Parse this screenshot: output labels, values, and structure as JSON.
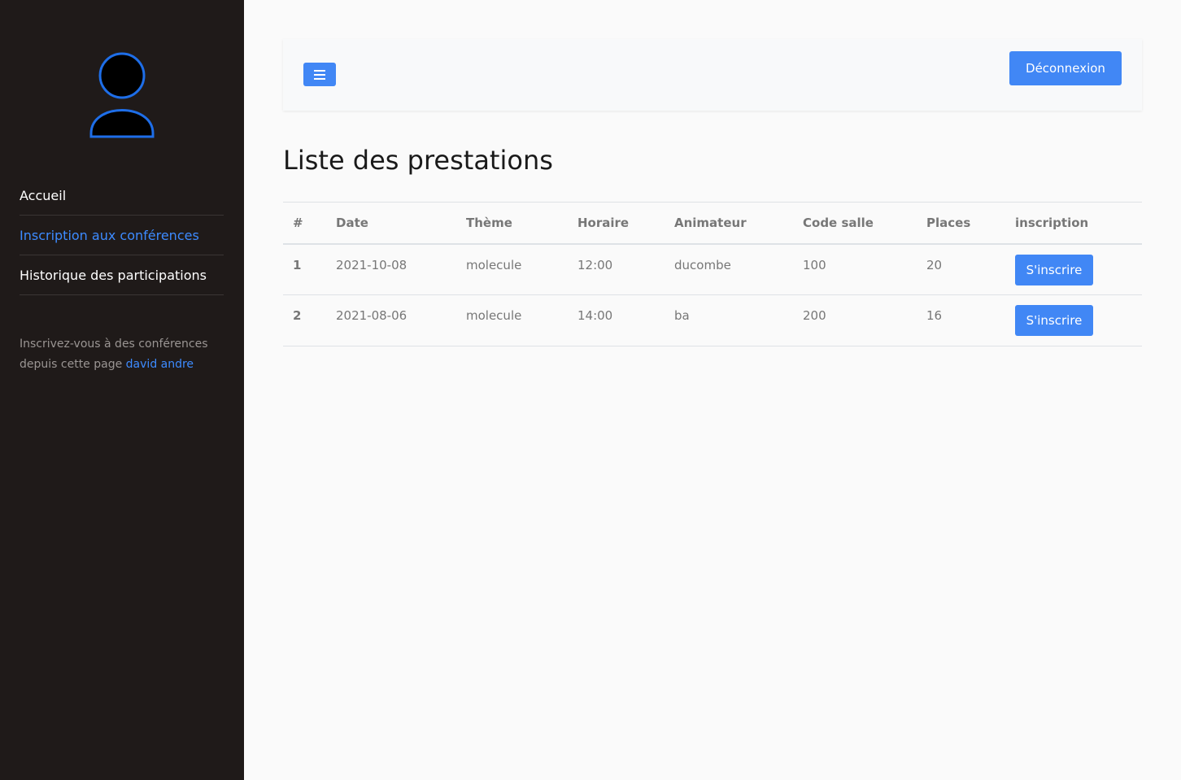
{
  "sidebar": {
    "nav": [
      {
        "label": "Accueil"
      },
      {
        "label": "Inscription aux conférences"
      },
      {
        "label": "Historique des participations"
      }
    ],
    "footer_text": "Inscrivez-vous à des conférences depuis cette page",
    "user_name": "david andre"
  },
  "header": {
    "menu_icon": "hamburger-icon",
    "logout_label": "Déconnexion"
  },
  "main": {
    "title": "Liste des prestations",
    "table": {
      "headers": [
        "#",
        "Date",
        "Thème",
        "Horaire",
        "Animateur",
        "Code salle",
        "Places",
        "inscription"
      ],
      "rows": [
        [
          "1",
          "2021-10-08",
          "molecule",
          "12:00",
          "ducombe",
          "100",
          "20",
          "S'inscrire"
        ],
        [
          "2",
          "2021-08-06",
          "molecule",
          "14:00",
          "ba",
          "200",
          "16",
          "S'inscrire"
        ]
      ]
    }
  },
  "colors": {
    "sidebar_bg": "#1f1a19",
    "accent": "#4187f5",
    "link": "#3d8bff"
  }
}
